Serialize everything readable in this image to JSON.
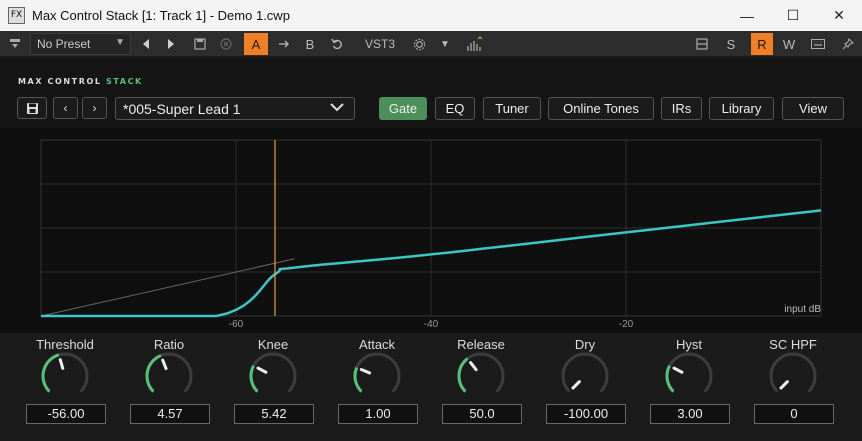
{
  "window": {
    "title": "Max Control Stack [1: Track 1] - Demo 1.cwp",
    "fx_badge": "FX",
    "minimize": "—",
    "maximize": "☐",
    "close": "✕"
  },
  "host": {
    "preset": "No Preset",
    "ab_a": "A",
    "ab_b": "B",
    "format": "VST3",
    "right_s": "S",
    "right_r": "R",
    "right_w": "W"
  },
  "plugin": {
    "brand_main": "MAX CONTROL",
    "brand_accent": "STACK",
    "preset_name": "*005-Super Lead 1",
    "tabs": [
      "Gate",
      "EQ",
      "Tuner",
      "Online Tones",
      "IRs",
      "Library",
      "View"
    ],
    "active_tab": "Gate"
  },
  "graph": {
    "x_label": "input dB",
    "ticks": [
      "-60",
      "-40",
      "-20"
    ],
    "curve_color": "#3cc7c2",
    "threshold_color": "#e8a23a"
  },
  "chart_data": {
    "type": "line",
    "xlabel": "input dB",
    "x_ticks": [
      -60,
      -40,
      -20
    ],
    "xlim": [
      -80,
      0
    ],
    "ylim": [
      -80,
      0
    ],
    "threshold_db": -56,
    "series": [
      {
        "x": [
          -80,
          -62,
          -56,
          -54,
          -40,
          -20,
          0
        ],
        "y": [
          -80,
          -80,
          -61,
          -58,
          -52,
          -42,
          -32
        ]
      }
    ]
  },
  "knobs": [
    {
      "label": "Threshold",
      "value": "-56.00",
      "level": 0.44
    },
    {
      "label": "Ratio",
      "value": "4.57",
      "level": 0.42
    },
    {
      "label": "Knee",
      "value": "5.42",
      "level": 0.27
    },
    {
      "label": "Attack",
      "value": "1.00",
      "level": 0.25
    },
    {
      "label": "Release",
      "value": "50.0",
      "level": 0.36
    },
    {
      "label": "Dry",
      "value": "-100.00",
      "level": 0.0
    },
    {
      "label": "Hyst",
      "value": "3.00",
      "level": 0.27
    },
    {
      "label": "SC HPF",
      "value": "0",
      "level": 0.0
    }
  ],
  "colors": {
    "accent_green": "#55c27a",
    "host_orange": "#f07f26"
  }
}
